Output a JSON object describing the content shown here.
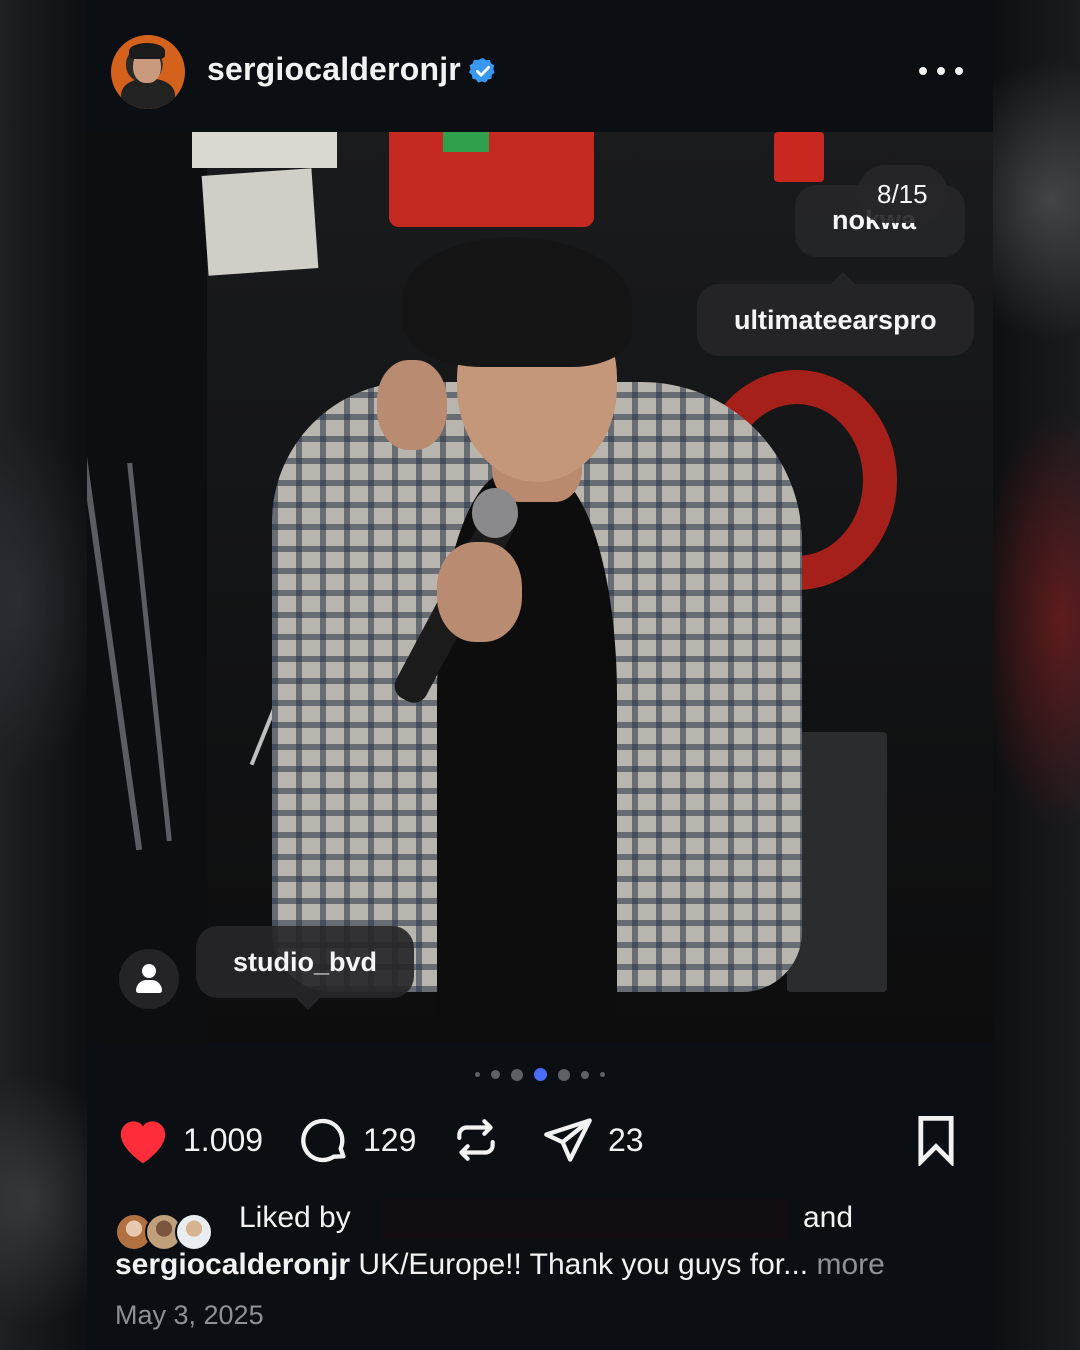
{
  "post": {
    "username": "sergiocalderonjr",
    "verified": true,
    "carousel_position": "8/15",
    "carousel_index": 8,
    "carousel_total": 15,
    "tags": {
      "top_partial": "nokwa",
      "ultimate": "ultimateearspro",
      "studio": "studio_bvd"
    }
  },
  "actions": {
    "likes": "1.009",
    "comments": "129",
    "shares": "23",
    "liked_color": "#ff2d3a"
  },
  "likes_row": {
    "prefix": "Liked by",
    "suffix": "and"
  },
  "caption": {
    "author": "sergiocalderonjr",
    "text": "UK/Europe!! Thank you guys for...",
    "more": "more"
  },
  "date": "May 3, 2025",
  "icons": [
    "verified-badge-icon",
    "more-options-icon",
    "user-tag-icon",
    "heart-icon",
    "comment-icon",
    "repost-icon",
    "send-icon",
    "bookmark-icon"
  ],
  "colors": {
    "background": "#0b0f14",
    "accent_blue": "#3897f0",
    "active_dot": "#4a6cf7"
  }
}
